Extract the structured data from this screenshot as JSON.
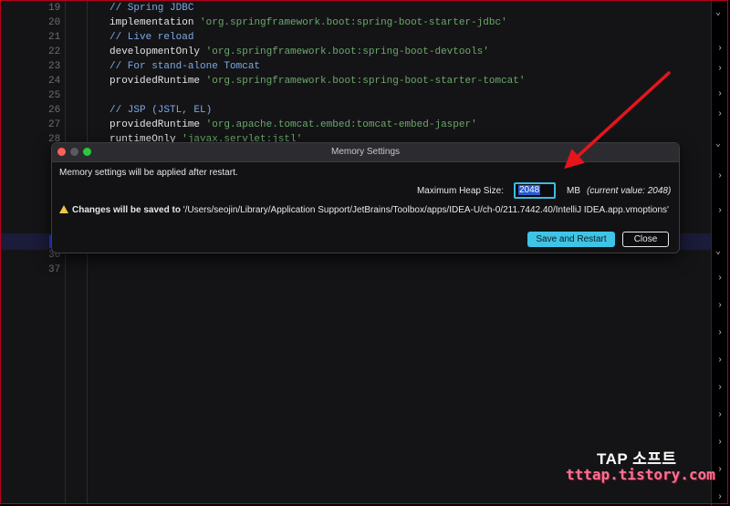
{
  "editor": {
    "lines": [
      {
        "num": "19",
        "parts": [
          {
            "t": "comment",
            "v": "// Spring JDBC"
          }
        ]
      },
      {
        "num": "20",
        "parts": [
          {
            "t": "kw",
            "v": "implementation "
          },
          {
            "t": "str",
            "v": "'org.springframework.boot:spring-boot-starter-jdbc'"
          }
        ]
      },
      {
        "num": "21",
        "parts": [
          {
            "t": "comment",
            "v": "// Live reload"
          }
        ]
      },
      {
        "num": "22",
        "parts": [
          {
            "t": "kw",
            "v": "developmentOnly "
          },
          {
            "t": "str",
            "v": "'org.springframework.boot:spring-boot-devtools'"
          }
        ]
      },
      {
        "num": "23",
        "parts": [
          {
            "t": "comment",
            "v": "// For stand-alone Tomcat"
          }
        ]
      },
      {
        "num": "24",
        "parts": [
          {
            "t": "kw",
            "v": "providedRuntime "
          },
          {
            "t": "str",
            "v": "'org.springframework.boot:spring-boot-starter-tomcat'"
          }
        ]
      },
      {
        "num": "25",
        "parts": []
      },
      {
        "num": "26",
        "parts": [
          {
            "t": "comment",
            "v": "// JSP (JSTL, EL)"
          }
        ]
      },
      {
        "num": "27",
        "parts": [
          {
            "t": "kw",
            "v": "providedRuntime "
          },
          {
            "t": "str",
            "v": "'org.apache.tomcat.embed:tomcat-embed-jasper'"
          }
        ]
      },
      {
        "num": "28",
        "parts": [
          {
            "t": "kw",
            "v": "runtimeOnly "
          },
          {
            "t": "str",
            "v": "'javax.servlet:jstl'"
          }
        ]
      }
    ],
    "line36": "36",
    "line37": "37"
  },
  "dialog": {
    "title": "Memory Settings",
    "message": "Memory settings will be applied after restart.",
    "heap_label": "Maximum Heap Size:",
    "heap_value": "2048",
    "unit": "MB",
    "current_value": "(current value: 2048)",
    "warning_bold": "Changes will be saved to",
    "warning_path": " '/Users/seojin/Library/Application Support/JetBrains/Toolbox/apps/IDEA-U/ch-0/211.7442.40/IntelliJ IDEA.app.vmoptions'",
    "save_label": "Save and Restart",
    "close_label": "Close"
  },
  "watermark": {
    "line1": "TAP 소프트",
    "line2": "tttap.tistory.com"
  },
  "colors": {
    "accent": "#3fc4e6",
    "arrow": "#e8141c",
    "warning": "#f2c744"
  }
}
